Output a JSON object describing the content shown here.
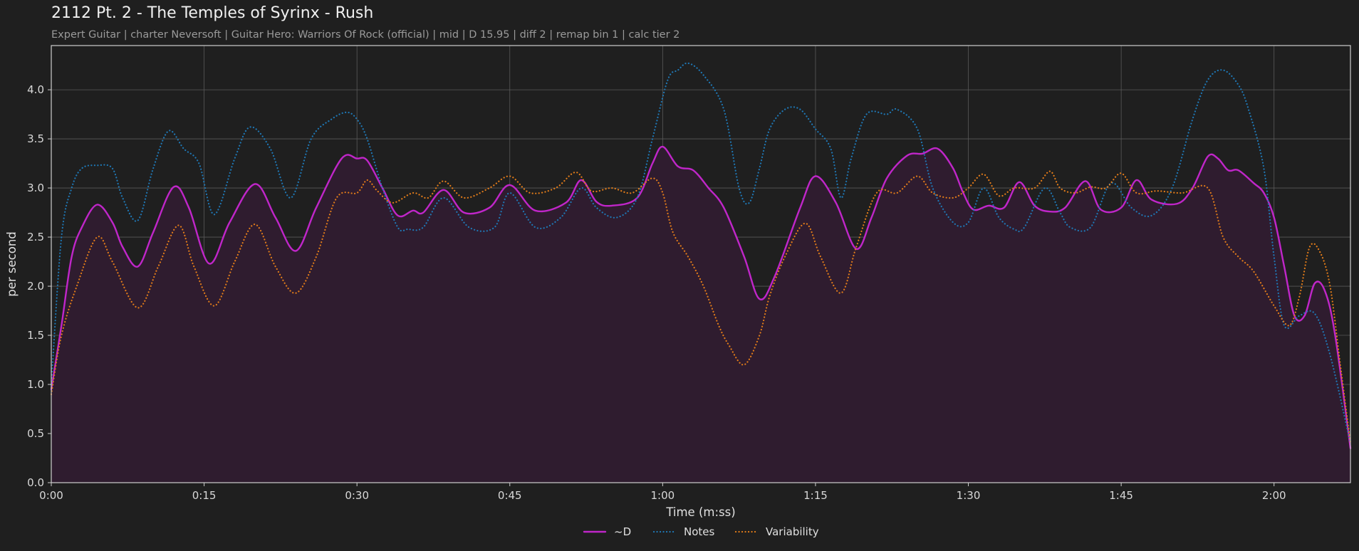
{
  "header": {
    "title": "2112 Pt. 2 - The Temples of Syrinx - Rush",
    "subtitle": "Expert Guitar  |  charter Neversoft  |  Guitar Hero: Warriors Of Rock (official)  |  mid  |  D 15.95  |  diff 2  |  remap bin 1  |  calc tier 2"
  },
  "colors": {
    "background": "#1f1f1f",
    "grid": "#5a5a5a",
    "axes": "#cfcfcf",
    "d": "#c026c9",
    "d_fill": "#2f1c2f",
    "notes": "#1f77b4",
    "variability": "#e07b1a"
  },
  "chart_data": {
    "type": "line",
    "xlabel": "Time (m:ss)",
    "ylabel": "per second",
    "xlim": [
      0,
      127.5
    ],
    "ylim": [
      0,
      4.45
    ],
    "x_ticks": [
      0,
      15,
      30,
      45,
      60,
      75,
      90,
      105,
      120
    ],
    "x_tick_labels": [
      "0:00",
      "0:15",
      "0:30",
      "0:45",
      "1:00",
      "1:15",
      "1:30",
      "1:45",
      "2:00"
    ],
    "y_ticks": [
      0,
      0.5,
      1.0,
      1.5,
      2.0,
      2.5,
      3.0,
      3.5,
      4.0
    ],
    "y_tick_labels": [
      "0.0",
      "0.5",
      "1.0",
      "1.5",
      "2.0",
      "2.5",
      "3.0",
      "3.5",
      "4.0"
    ],
    "grid": true,
    "legend_position": "bottom-center",
    "series": [
      {
        "name": "~D",
        "style": "solid",
        "filled": true,
        "x": [
          0,
          1,
          2,
          3,
          4.5,
          6,
          7,
          8.5,
          10,
          12,
          13.5,
          15.5,
          17.5,
          20,
          22,
          24,
          26,
          28.5,
          30,
          31,
          32.5,
          34,
          35.5,
          36.5,
          38.5,
          40.5,
          43,
          45,
          47.5,
          50.5,
          52,
          53.5,
          55,
          57.5,
          59,
          60,
          61.5,
          63,
          64.5,
          66,
          68,
          69.5,
          71,
          73.5,
          75,
          77,
          79,
          80.5,
          82,
          84,
          85.5,
          87,
          88.5,
          89.5,
          90.5,
          92,
          93.5,
          95,
          96.5,
          98,
          99.5,
          101.5,
          103,
          105,
          106.5,
          108,
          110.5,
          112,
          113.5,
          114.5,
          115.5,
          116.5,
          118,
          119,
          120,
          121,
          122,
          123,
          124,
          125,
          126,
          127.5
        ],
        "y": [
          0.95,
          1.6,
          2.3,
          2.6,
          2.83,
          2.65,
          2.4,
          2.2,
          2.55,
          3.01,
          2.8,
          2.23,
          2.65,
          3.04,
          2.7,
          2.36,
          2.8,
          3.3,
          3.3,
          3.28,
          3.0,
          2.72,
          2.77,
          2.75,
          2.98,
          2.75,
          2.8,
          3.03,
          2.77,
          2.85,
          3.08,
          2.86,
          2.82,
          2.9,
          3.25,
          3.42,
          3.22,
          3.18,
          3.0,
          2.8,
          2.3,
          1.87,
          2.1,
          2.8,
          3.12,
          2.85,
          2.38,
          2.7,
          3.1,
          3.33,
          3.35,
          3.4,
          3.2,
          2.95,
          2.78,
          2.82,
          2.8,
          3.06,
          2.82,
          2.76,
          2.8,
          3.07,
          2.78,
          2.8,
          3.08,
          2.88,
          2.84,
          3.0,
          3.32,
          3.3,
          3.18,
          3.18,
          3.05,
          2.95,
          2.7,
          2.2,
          1.7,
          1.7,
          2.03,
          1.95,
          1.5,
          0.35
        ]
      },
      {
        "name": "Notes",
        "style": "dotted",
        "filled": false,
        "x": [
          0,
          1,
          2,
          3,
          4.5,
          6,
          7,
          8.5,
          10,
          11.5,
          13,
          14.5,
          16,
          18,
          19.5,
          21.5,
          23.5,
          25.5,
          27.5,
          29,
          30,
          31,
          32.5,
          34,
          35,
          36.5,
          38.5,
          41,
          43.5,
          45,
          47.5,
          50,
          52,
          53.5,
          55.5,
          57.5,
          59,
          60.5,
          61.5,
          62.5,
          64,
          66,
          67.5,
          68.5,
          69.5,
          70.5,
          72,
          73.5,
          75,
          76.5,
          77.5,
          78.5,
          80,
          82,
          83,
          85,
          86.5,
          88.5,
          90,
          91.5,
          93,
          94.5,
          95.5,
          97.5,
          99,
          100,
          102,
          104,
          106,
          108,
          110,
          112,
          113.5,
          115,
          116.5,
          117.5,
          119,
          120,
          121,
          122.5,
          124,
          125.5,
          127.5
        ],
        "y": [
          1.0,
          2.5,
          3.0,
          3.2,
          3.23,
          3.2,
          2.9,
          2.67,
          3.2,
          3.58,
          3.4,
          3.25,
          2.73,
          3.3,
          3.62,
          3.4,
          2.9,
          3.5,
          3.7,
          3.77,
          3.7,
          3.5,
          3.0,
          2.6,
          2.58,
          2.6,
          2.9,
          2.6,
          2.6,
          2.95,
          2.6,
          2.7,
          3.0,
          2.8,
          2.7,
          2.9,
          3.5,
          4.1,
          4.2,
          4.27,
          4.15,
          3.8,
          3.0,
          2.85,
          3.2,
          3.6,
          3.8,
          3.8,
          3.6,
          3.4,
          2.9,
          3.3,
          3.75,
          3.75,
          3.8,
          3.6,
          3.0,
          2.65,
          2.65,
          3.0,
          2.7,
          2.58,
          2.6,
          3.0,
          2.75,
          2.6,
          2.6,
          3.05,
          2.8,
          2.72,
          3.0,
          3.7,
          4.1,
          4.2,
          4.05,
          3.8,
          3.2,
          2.3,
          1.6,
          1.7,
          1.72,
          1.3,
          0.4
        ]
      },
      {
        "name": "Variability",
        "style": "dotted",
        "filled": false,
        "x": [
          0,
          1,
          2.5,
          4.5,
          6,
          8.5,
          10.5,
          12.5,
          14,
          16,
          18,
          20,
          22,
          24,
          26,
          28,
          30,
          31,
          32,
          33.5,
          35.5,
          37,
          38.5,
          40.5,
          43,
          45,
          47,
          49.5,
          51.5,
          53,
          55,
          57,
          59,
          60,
          61,
          62.5,
          64,
          65.5,
          66.5,
          68,
          69.5,
          70.5,
          72,
          74,
          75.5,
          77.5,
          79,
          81,
          83,
          85,
          86.5,
          88.5,
          90,
          91.5,
          93,
          94.5,
          96.5,
          98,
          99,
          100.5,
          102,
          103.5,
          105,
          106.5,
          108.5,
          111,
          113.5,
          115,
          116.5,
          118,
          120,
          121.5,
          122.5,
          123.5,
          124.5,
          125.5,
          126.5,
          127.5
        ],
        "y": [
          0.9,
          1.5,
          2.0,
          2.5,
          2.25,
          1.78,
          2.2,
          2.62,
          2.2,
          1.8,
          2.25,
          2.63,
          2.2,
          1.93,
          2.3,
          2.9,
          2.95,
          3.08,
          2.97,
          2.85,
          2.95,
          2.9,
          3.07,
          2.9,
          3.0,
          3.12,
          2.95,
          3.0,
          3.16,
          2.97,
          3.0,
          2.95,
          3.1,
          2.95,
          2.55,
          2.3,
          2.0,
          1.6,
          1.4,
          1.2,
          1.5,
          1.9,
          2.3,
          2.64,
          2.3,
          1.93,
          2.4,
          2.95,
          2.95,
          3.12,
          2.95,
          2.9,
          3.0,
          3.14,
          2.92,
          3.0,
          3.0,
          3.17,
          3.0,
          2.95,
          3.01,
          3.0,
          3.15,
          2.95,
          2.97,
          2.95,
          3.0,
          2.5,
          2.3,
          2.15,
          1.8,
          1.6,
          1.9,
          2.4,
          2.35,
          2.0,
          1.2,
          0.4
        ]
      }
    ]
  }
}
